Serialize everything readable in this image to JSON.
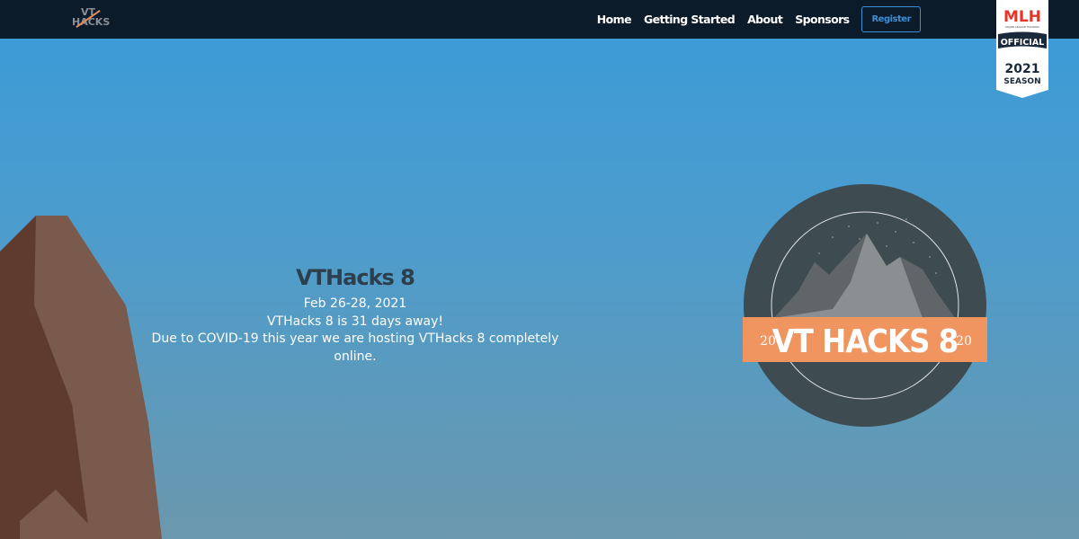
{
  "nav": {
    "logo_top": "VT",
    "logo_bottom": "HACKS",
    "links": [
      "Home",
      "Getting Started",
      "About",
      "Sponsors"
    ],
    "register_label": "Register"
  },
  "mlh_badge": {
    "brand": "MLH",
    "sub": "MAJOR LEAGUE HACKING",
    "official": "OFFICIAL",
    "year": "2021",
    "season": "SEASON"
  },
  "hero": {
    "title": "VTHacks 8",
    "date": "Feb 26-28, 2021",
    "countdown": "VTHacks 8 is 31 days away!",
    "notice": "Due to COVID-19 this year we are hosting VTHacks 8 completely online."
  },
  "emblem": {
    "left_year": "20",
    "name": "VT HACKS 8",
    "right_year": "20"
  },
  "colors": {
    "navbar": "#0b1b2a",
    "sky_top": "#3a9bd8",
    "sky_bottom": "#6b98ad",
    "accent": "#f0955f",
    "register": "#3b8fd6"
  }
}
